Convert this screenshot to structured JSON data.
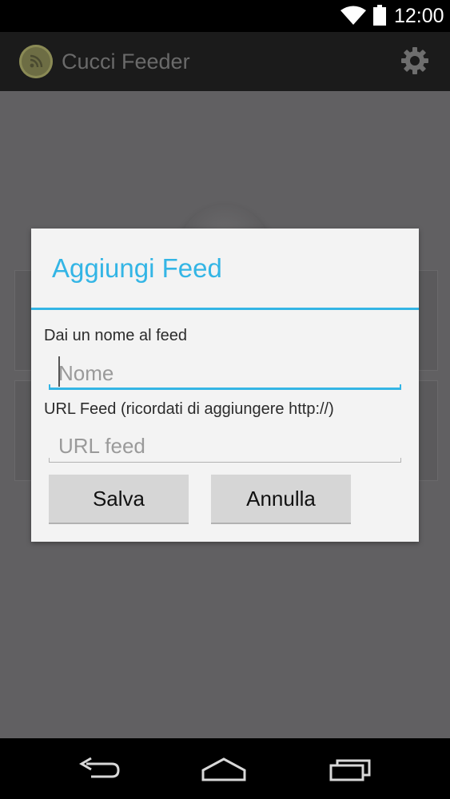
{
  "status_bar": {
    "time": "12:00",
    "icons": [
      "wifi-icon",
      "battery-icon"
    ]
  },
  "action_bar": {
    "title": "Cucci Feeder",
    "app_icon": "rss-icon",
    "settings_icon": "gear-icon"
  },
  "background": {
    "add_button_icon": "plus-icon"
  },
  "dialog": {
    "title": "Aggiungi Feed",
    "name_label": "Dai un nome al feed",
    "name_placeholder": "Nome",
    "url_label": "URL Feed (ricordati di aggiungere http://)",
    "url_placeholder": "URL feed",
    "save_label": "Salva",
    "cancel_label": "Annulla"
  },
  "nav_bar": {
    "icons": [
      "back-icon",
      "home-icon",
      "recents-icon"
    ]
  },
  "colors": {
    "accent": "#33b5e5",
    "dialog_bg": "#f3f3f3",
    "dim_bg": "#616062",
    "action_bar_bg": "#1b1b1b",
    "button_bg": "#d6d6d6"
  }
}
